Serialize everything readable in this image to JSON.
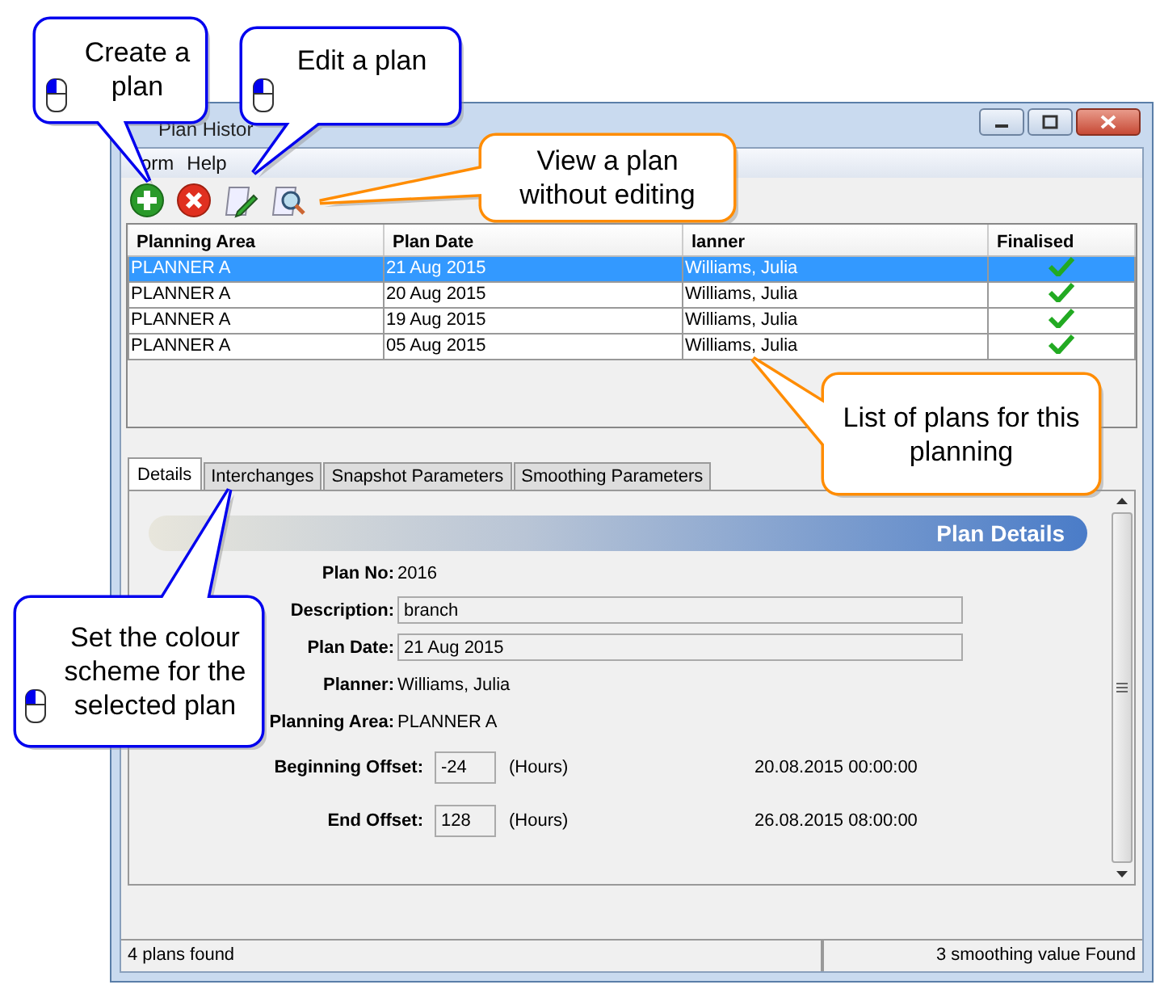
{
  "window": {
    "title": "Plan Histor"
  },
  "menu": [
    {
      "label": "orm"
    },
    {
      "label": "Help"
    }
  ],
  "toolbar": [
    {
      "kind": "add"
    },
    {
      "kind": "delete"
    },
    {
      "kind": "edit"
    },
    {
      "kind": "view"
    }
  ],
  "table": {
    "columns": [
      "Planning Area",
      "Plan Date",
      "lanner",
      "Finalised"
    ],
    "rows": [
      {
        "cells": [
          "PLANNER A",
          "21 Aug 2015",
          "Williams, Julia"
        ],
        "finalised": true,
        "selected": true
      },
      {
        "cells": [
          "PLANNER A",
          "20 Aug 2015",
          "Williams, Julia"
        ],
        "finalised": true,
        "selected": false
      },
      {
        "cells": [
          "PLANNER A",
          "19 Aug 2015",
          "Williams, Julia"
        ],
        "finalised": true,
        "selected": false
      },
      {
        "cells": [
          "PLANNER A",
          "05 Aug 2015",
          "Williams, Julia"
        ],
        "finalised": true,
        "selected": false
      }
    ]
  },
  "tabs": [
    {
      "label": "Details",
      "selected": true
    },
    {
      "label": "Interchanges",
      "selected": false
    },
    {
      "label": "Snapshot Parameters",
      "selected": false
    },
    {
      "label": "Smoothing Parameters",
      "selected": false
    }
  ],
  "details": {
    "title": "Plan Details",
    "fields": [
      {
        "label": "Plan No:",
        "value": "2016",
        "kind": "text"
      },
      {
        "label": "Description:",
        "value": "branch",
        "kind": "input"
      },
      {
        "label": "Plan Date:",
        "value": "21 Aug 2015",
        "kind": "input"
      },
      {
        "label": "Planner:",
        "value": "Williams, Julia",
        "kind": "text"
      },
      {
        "label": "Planning Area:",
        "value": "PLANNER A",
        "kind": "text"
      }
    ],
    "offsets": [
      {
        "label": "Beginning Offset:",
        "value": "-24",
        "unit": "(Hours)",
        "datetime": "20.08.2015 00:00:00"
      },
      {
        "label": "End Offset:",
        "value": "128",
        "unit": "(Hours)",
        "datetime": "26.08.2015 08:00:00"
      }
    ]
  },
  "status_bar": [
    "4 plans found",
    "3 smoothing value Found"
  ],
  "callouts": [
    {
      "text": "Create a plan",
      "color": "#0000ee",
      "mouse": true
    },
    {
      "text": "Edit a plan",
      "color": "#0000ee",
      "mouse": true
    },
    {
      "text": "View a plan without editing",
      "color": "#ff8c00",
      "mouse": false
    },
    {
      "text": "List of plans for this planning",
      "color": "#ff8c00",
      "mouse": false
    },
    {
      "text": "Set the colour scheme for the selected plan",
      "color": "#0000ee",
      "mouse": true
    }
  ]
}
